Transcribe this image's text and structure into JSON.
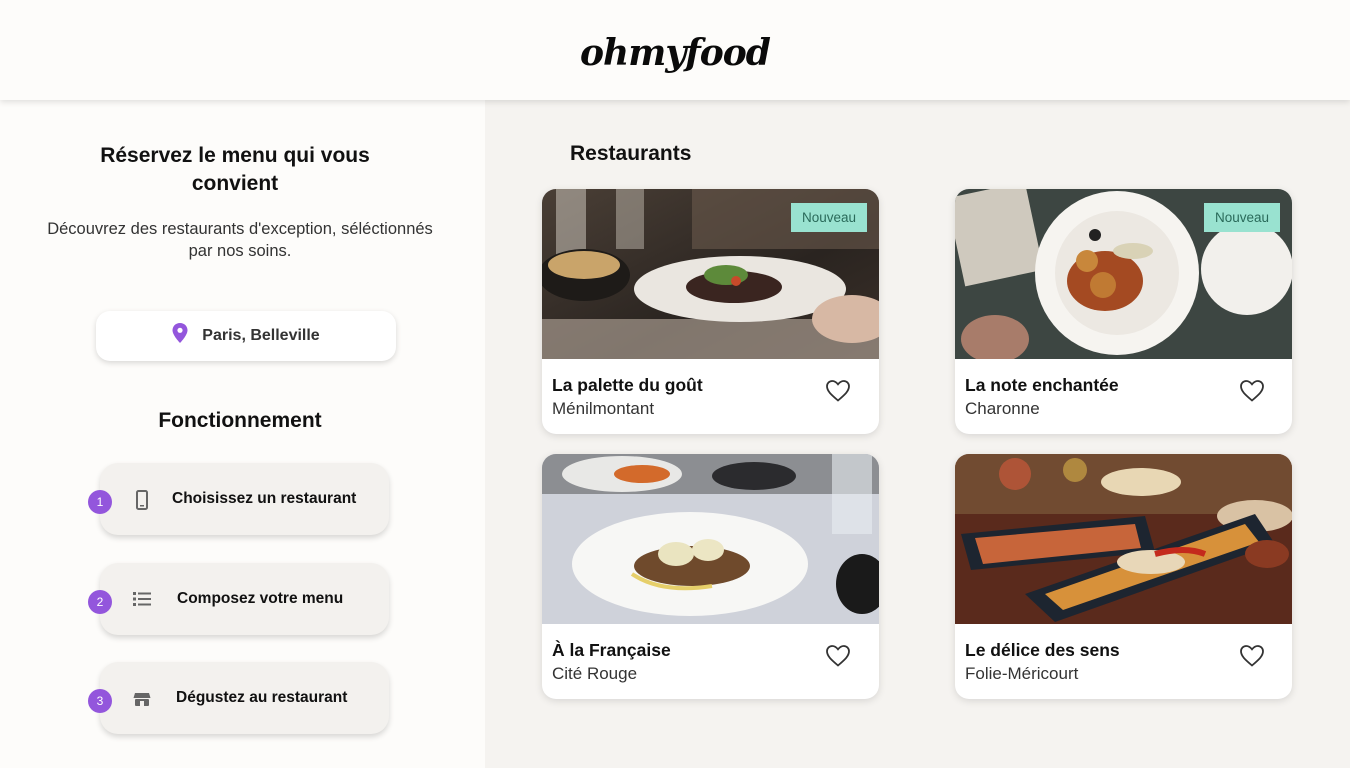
{
  "brand": {
    "logo": "ohmyfood"
  },
  "hero": {
    "title": "Réservez le menu qui vous convient",
    "subtitle": "Découvrez des restaurants d'exception, séléctionnés par nos soins."
  },
  "location": {
    "icon": "map-pin-icon",
    "label": "Paris, Belleville"
  },
  "how": {
    "title": "Fonctionnement",
    "steps": [
      {
        "num": "1",
        "icon": "smartphone-icon",
        "label": "Choisissez un restaurant"
      },
      {
        "num": "2",
        "icon": "list-icon",
        "label": "Composez votre menu"
      },
      {
        "num": "3",
        "icon": "store-icon",
        "label": "Dégustez au restaurant"
      }
    ]
  },
  "restaurants": {
    "title": "Restaurants",
    "items": [
      {
        "name": "La palette du goût",
        "area": "Ménilmontant",
        "badge": "Nouveau"
      },
      {
        "name": "La note enchantée",
        "area": "Charonne",
        "badge": "Nouveau"
      },
      {
        "name": "À la Française",
        "area": "Cité Rouge",
        "badge": ""
      },
      {
        "name": "Le délice des sens",
        "area": "Folie-Méricourt",
        "badge": ""
      }
    ]
  },
  "colors": {
    "accent": "#9356dc",
    "badge_bg": "#99e2d0",
    "badge_text": "#2a6a5a"
  }
}
